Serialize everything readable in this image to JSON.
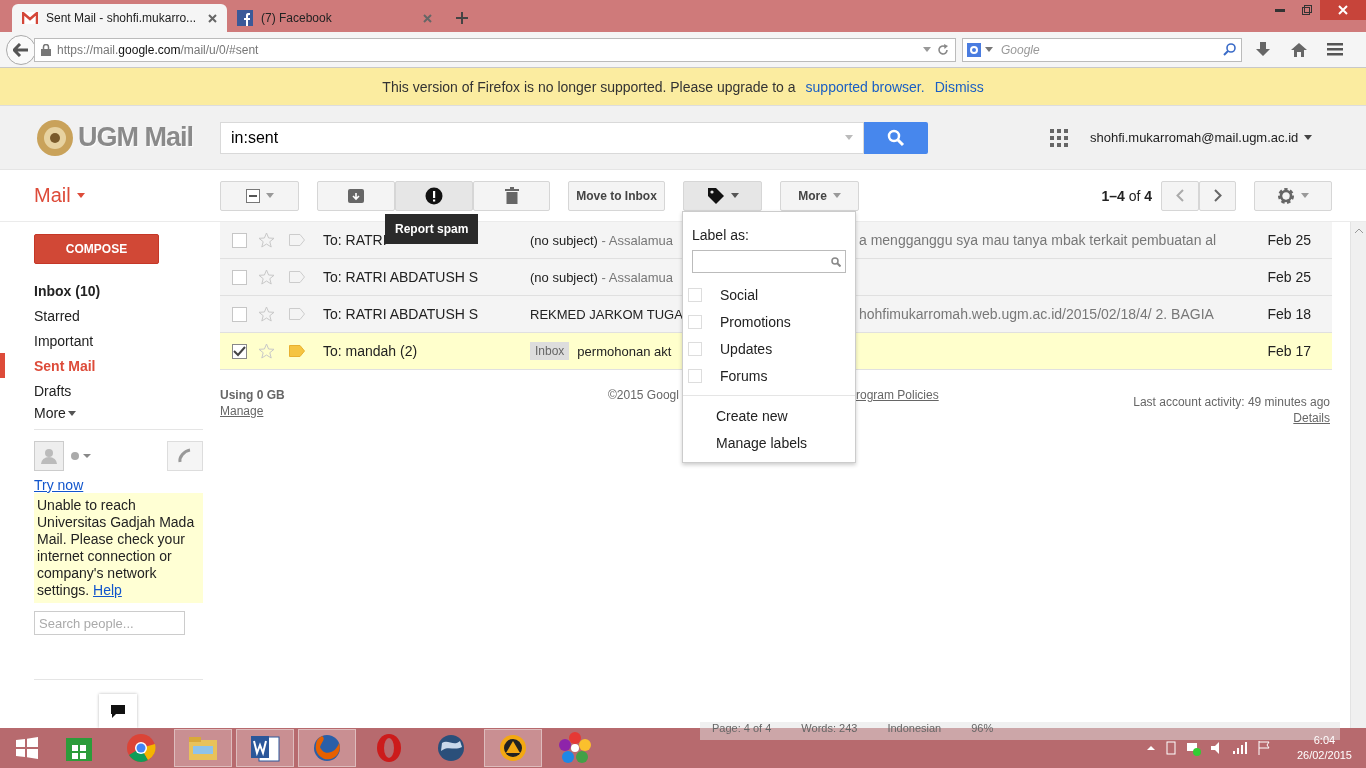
{
  "browser": {
    "tabs": [
      {
        "title": "Sent Mail - shohfi.mukarro...",
        "selected": true
      },
      {
        "title": "(7) Facebook",
        "selected": false
      }
    ],
    "url": {
      "prefix": "https://mail.",
      "host": "google.com",
      "path": "/mail/u/0/#sent"
    },
    "search_placeholder": "Google"
  },
  "notice": {
    "text": "This version of Firefox is no longer supported. Please upgrade to a",
    "link": "supported browser.",
    "dismiss": "Dismiss"
  },
  "header": {
    "logo": "UGM Mail",
    "search_value": "in:sent",
    "account": "shohfi.mukarromah@mail.ugm.ac.id"
  },
  "toolbar": {
    "app_menu": "Mail",
    "move_button": "Move to Inbox",
    "more_button": "More",
    "range": "1–4",
    "of": "of",
    "total": "4",
    "tooltip": "Report spam"
  },
  "sidebar": {
    "compose": "COMPOSE",
    "items": [
      {
        "label": "Inbox (10)",
        "unread": true,
        "selected": false
      },
      {
        "label": "Starred",
        "unread": false,
        "selected": false
      },
      {
        "label": "Important",
        "unread": false,
        "selected": false
      },
      {
        "label": "Sent Mail",
        "unread": false,
        "selected": true
      },
      {
        "label": "Drafts",
        "unread": false,
        "selected": false
      }
    ],
    "more": "More",
    "chat": {
      "try_now": "Try now",
      "message": "Unable to reach Universitas Gadjah Mada Mail. Please check your internet connection or company's network settings.",
      "help": "Help",
      "search_placeholder": "Search people..."
    }
  },
  "messages": [
    {
      "to": "To: RATRI",
      "subject": "(no subject)",
      "snippet": "- Assalamua",
      "snippet_tail": "a mengganggu sya mau tanya mbak terkait pembuatan al",
      "date": "Feb 25",
      "checked": false,
      "important": false
    },
    {
      "to": "To: RATRI ABDATUSH S",
      "subject": "(no subject)",
      "snippet": "- Assalamua",
      "date": "Feb 25",
      "checked": false,
      "important": false
    },
    {
      "to": "To: RATRI ABDATUSH S",
      "subject": "REKMED JARKOM TUGA",
      "snippet_tail": "hohfimukarromah.web.ugm.ac.id/2015/02/18/4/ 2. BAGIA",
      "date": "Feb 18",
      "checked": false,
      "important": false
    },
    {
      "to": "To: mandah (2)",
      "label": "Inbox",
      "subject": "permohonan akt",
      "date": "Feb 17",
      "checked": true,
      "important": true
    }
  ],
  "footer": {
    "usage": "Using 0 GB",
    "manage": "Manage",
    "copyright": "©2015 Googl",
    "policies": "rogram Policies",
    "activity": "Last account activity: 49 minutes ago",
    "details": "Details"
  },
  "label_menu": {
    "title": "Label as:",
    "labels": [
      {
        "name": "Social",
        "checked": false
      },
      {
        "name": "Promotions",
        "checked": false
      },
      {
        "name": "Updates",
        "checked": false
      },
      {
        "name": "Forums",
        "checked": false
      }
    ],
    "actions": [
      "Create new",
      "Manage labels"
    ]
  },
  "taskbar": {
    "apps": [
      {
        "kind": "store",
        "active": false
      },
      {
        "kind": "chrome",
        "active": false
      },
      {
        "kind": "explorer",
        "active": true
      },
      {
        "kind": "word",
        "active": true
      },
      {
        "kind": "firefox",
        "active": true
      },
      {
        "kind": "opera",
        "active": false
      },
      {
        "kind": "globe",
        "active": false
      },
      {
        "kind": "player",
        "active": true
      },
      {
        "kind": "flower",
        "active": false
      }
    ],
    "word_status": [
      "Page: 4 of 4",
      "Words: 243",
      "Indonesian",
      "96%"
    ],
    "time": "6:04",
    "date": "26/02/2015"
  }
}
